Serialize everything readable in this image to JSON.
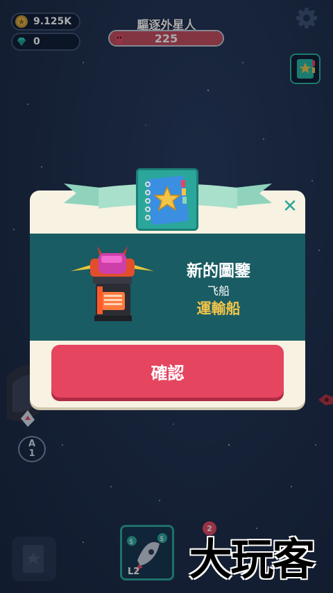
{
  "hud": {
    "coins": "9.125K",
    "gems": "0",
    "coin_icon": "coin-icon",
    "gem_icon": "gem-icon",
    "settings_icon": "gear-icon"
  },
  "mission": {
    "title": "驅逐外星人",
    "count": "225",
    "progress": 1.0,
    "bar_color": "#c74a5a"
  },
  "modal": {
    "title": "新的圖鑒",
    "category": "飞船",
    "item_name": "運輸船",
    "confirm_label": "確認",
    "close_icon": "close-icon",
    "emblem_icon": "star-notebook-icon",
    "accent_color": "#2aa79a",
    "band_color": "#1a5c63",
    "button_color": "#e5455f",
    "name_color": "#f2c548"
  },
  "game": {
    "level_letter": "A",
    "level_number": "1",
    "merge_slot_level": "L2",
    "notification_count": "2"
  },
  "watermark": "大玩客"
}
